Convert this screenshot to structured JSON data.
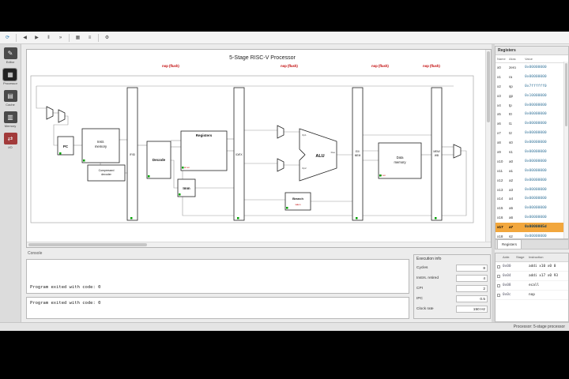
{
  "toolbar": {
    "buttons": [
      {
        "name": "reset",
        "glyph": "⟳"
      },
      {
        "name": "reverse",
        "glyph": "◀"
      },
      {
        "name": "step",
        "glyph": "▶"
      },
      {
        "name": "pause",
        "glyph": "‖"
      },
      {
        "name": "run",
        "glyph": "»"
      },
      {
        "name": "pipeline-table",
        "glyph": "▦"
      },
      {
        "name": "display-values",
        "glyph": "≡"
      },
      {
        "name": "settings",
        "glyph": "⚙"
      }
    ]
  },
  "sidebar": {
    "items": [
      {
        "id": "editor",
        "label": "Editor",
        "glyph": "✎"
      },
      {
        "id": "processor",
        "label": "Processor",
        "glyph": "▦"
      },
      {
        "id": "cache",
        "label": "Cache",
        "glyph": "▤"
      },
      {
        "id": "memory",
        "label": "Memory",
        "glyph": "▥"
      },
      {
        "id": "io",
        "label": "I/O",
        "glyph": "⇄"
      }
    ]
  },
  "diagram": {
    "title": "5-Stage RISC-V Processor",
    "flush_label": "nop (flush)",
    "components": {
      "pc": "PC",
      "instr_memory": [
        "Instr.",
        "memory"
      ],
      "compressed_decoder": [
        "Compressed",
        "decoder"
      ],
      "decode": "Decode",
      "registers": "Registers",
      "imm": "Imm",
      "alu": "ALU",
      "branch": "Branch",
      "data_memory": [
        "Data",
        "memory"
      ],
      "ifid": "IF/ID",
      "idex": "ID/EX",
      "exmem": [
        "EX/",
        "MEM"
      ],
      "memwb": [
        "MEM/",
        "WB"
      ]
    },
    "ports": {
      "op1": "Op1",
      "op2": "Op2",
      "res": "Res",
      "wr_en": "wr en",
      "taken": "taken"
    }
  },
  "console": {
    "label": "Console",
    "lines": [
      "Program exited with code: 0",
      "Program exited with code: 0"
    ]
  },
  "execution_info": {
    "title": "Execution info",
    "rows": [
      {
        "label": "Cycles",
        "value": "8"
      },
      {
        "label": "Instrs. retired",
        "value": "4"
      },
      {
        "label": "CPI",
        "value": "2"
      },
      {
        "label": "IPC",
        "value": "0.5"
      },
      {
        "label": "Clock rate",
        "value": "150 Hz"
      }
    ]
  },
  "registers_panel": {
    "title": "Registers",
    "tab": "Registers",
    "columns": {
      "name": "Name",
      "alias": "Alias",
      "value": "Value"
    },
    "highlight_color": "#f2a73d",
    "value_color": "#3d7a9e",
    "rows": [
      {
        "name": "x0",
        "alias": "zero",
        "value": "0x00000000"
      },
      {
        "name": "x1",
        "alias": "ra",
        "value": "0x00000000"
      },
      {
        "name": "x2",
        "alias": "sp",
        "value": "0x7ffffff0"
      },
      {
        "name": "x3",
        "alias": "gp",
        "value": "0x10000000"
      },
      {
        "name": "x4",
        "alias": "tp",
        "value": "0x00000000"
      },
      {
        "name": "x5",
        "alias": "t0",
        "value": "0x00000000"
      },
      {
        "name": "x6",
        "alias": "t1",
        "value": "0x00000000"
      },
      {
        "name": "x7",
        "alias": "t2",
        "value": "0x00000000"
      },
      {
        "name": "x8",
        "alias": "s0",
        "value": "0x00000000"
      },
      {
        "name": "x9",
        "alias": "s1",
        "value": "0x00000000"
      },
      {
        "name": "x10",
        "alias": "a0",
        "value": "0x00000000"
      },
      {
        "name": "x11",
        "alias": "a1",
        "value": "0x00000000"
      },
      {
        "name": "x12",
        "alias": "a2",
        "value": "0x00000000"
      },
      {
        "name": "x13",
        "alias": "a3",
        "value": "0x00000000"
      },
      {
        "name": "x14",
        "alias": "a4",
        "value": "0x00000000"
      },
      {
        "name": "x15",
        "alias": "a5",
        "value": "0x00000000"
      },
      {
        "name": "x16",
        "alias": "a6",
        "value": "0x00000000"
      },
      {
        "name": "x17",
        "alias": "a7",
        "value": "0x0000005d"
      },
      {
        "name": "x18",
        "alias": "s2",
        "value": "0x00000000"
      }
    ]
  },
  "instruction_memory": {
    "columns": {
      "addr": "Addr.",
      "stage": "Stage",
      "instr": "Instruction"
    },
    "rows": [
      {
        "addr": "0x00",
        "stage": "",
        "instr": "addi x10 x0 0"
      },
      {
        "addr": "0x04",
        "stage": "",
        "instr": "addi x17 x0 93"
      },
      {
        "addr": "0x08",
        "stage": "",
        "instr": "ecall"
      },
      {
        "addr": "0x0c",
        "stage": "",
        "instr": "nop"
      }
    ]
  },
  "status_bar": {
    "right": "Processor: 5-stage processor"
  }
}
